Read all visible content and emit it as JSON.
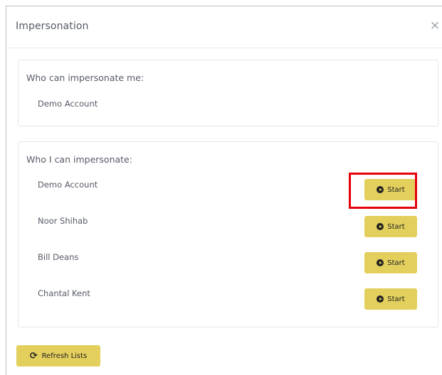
{
  "modal": {
    "title": "Impersonation",
    "close_icon": "×"
  },
  "who_can_impersonate_me": {
    "heading": "Who can impersonate me:",
    "people": [
      "Demo Account"
    ]
  },
  "who_i_can_impersonate": {
    "heading": "Who I can impersonate:",
    "people": [
      {
        "name": "Demo Account",
        "action": "Start"
      },
      {
        "name": "Noor Shihab",
        "action": "Start"
      },
      {
        "name": "Bill Deans",
        "action": "Start"
      },
      {
        "name": "Chantal Kent",
        "action": "Start"
      }
    ]
  },
  "footer": {
    "refresh_label": "Refresh Lists",
    "refresh_icon": "⟳"
  },
  "colors": {
    "button_bg": "#e3cf5c",
    "highlight": "#e8000b",
    "text": "#555a66"
  }
}
